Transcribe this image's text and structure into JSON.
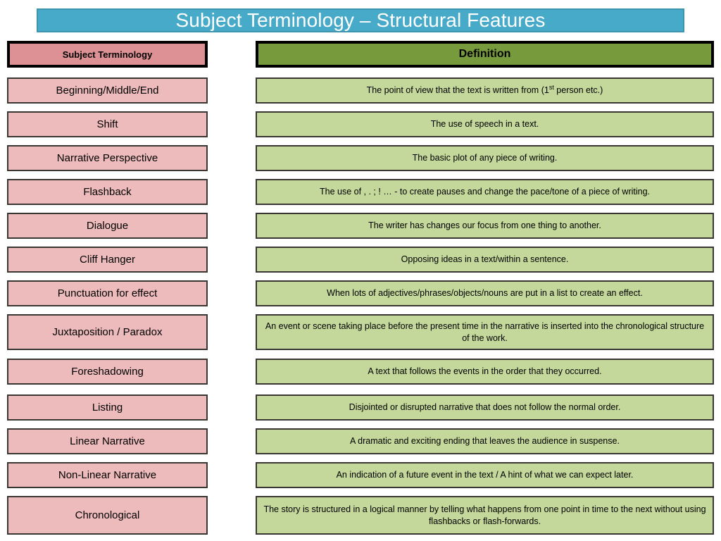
{
  "slide": {
    "title": "Subject Terminology – Structural Features",
    "title_bg": "#46aac8",
    "title_color": "#ffffff"
  },
  "table": {
    "headers": {
      "term": "Subject Terminology",
      "definition": "Definition",
      "term_bg": "#dd9195",
      "definition_bg": "#779a3d"
    },
    "term_cell_bg": "#eebbbc",
    "definition_cell_bg": "#c3d89a",
    "rows": [
      {
        "term": "Beginning/Middle/End",
        "definition_pre": "The point of view that the text is written from (1",
        "definition_sup": "st",
        "definition_post": " person etc.)",
        "definition": "The point of view that the text is written from (1st person etc.)"
      },
      {
        "term": "Shift",
        "definition": "The use of speech in a text."
      },
      {
        "term": "Narrative Perspective",
        "definition": "The basic plot of any piece of writing."
      },
      {
        "term": "Flashback",
        "definition": "The use of , . ; ! … - to create pauses and change the pace/tone of a piece of writing."
      },
      {
        "term": "Dialogue",
        "definition": "The writer has changes our focus from one thing to another."
      },
      {
        "term": "Cliff Hanger",
        "definition": "Opposing ideas in a text/within a sentence."
      },
      {
        "term": "Punctuation for effect",
        "definition": "When lots of adjectives/phrases/objects/nouns are put in a list to create an effect."
      },
      {
        "term": "Juxtaposition / Paradox",
        "definition": "An event or scene taking place before the present time in the narrative is inserted into the chronological structure of the work."
      },
      {
        "term": "Foreshadowing",
        "definition": "A text that follows the events in the order that they occurred."
      },
      {
        "term": "Listing",
        "definition": "Disjointed or disrupted narrative that does not follow the normal order."
      },
      {
        "term": "Linear Narrative",
        "definition": "A dramatic and exciting ending that leaves the audience in suspense."
      },
      {
        "term": "Non-Linear Narrative",
        "definition": "An indication of a future event in the text / A hint of what we can expect later."
      },
      {
        "term": "Chronological",
        "definition": "The story is structured in a logical manner by telling what happens from one point in time to the next without using flashbacks or flash-forwards."
      }
    ]
  }
}
